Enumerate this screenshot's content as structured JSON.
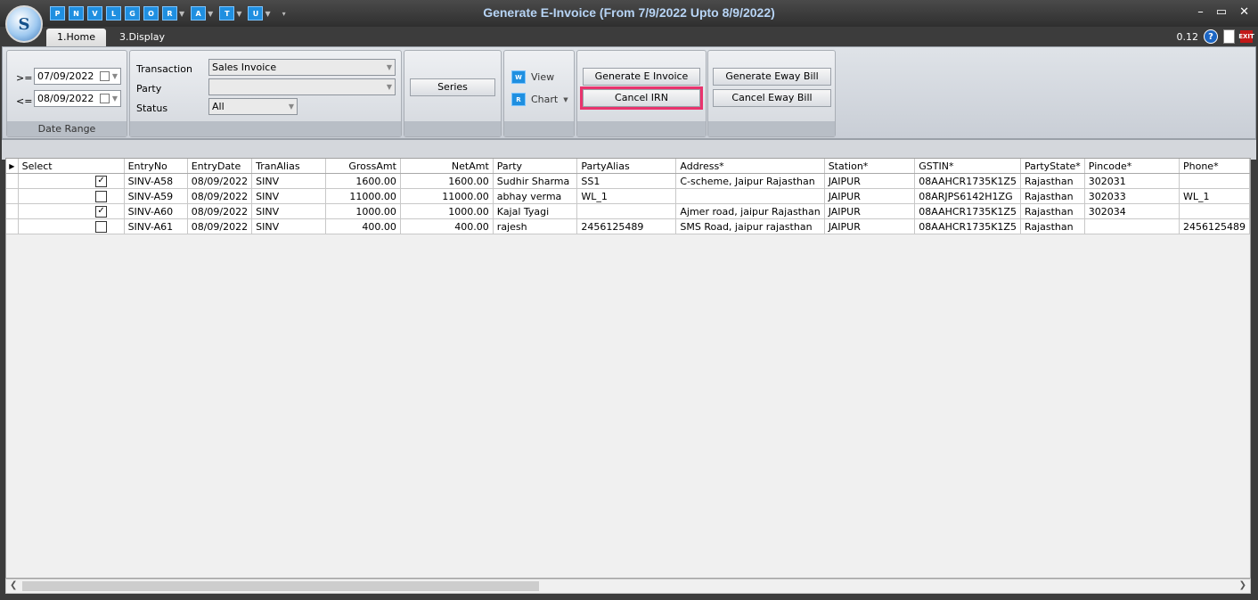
{
  "app": {
    "logo_text": "S",
    "title": "Generate E-Invoice (From 7/9/2022 Upto 8/9/2022)",
    "quick_access": [
      {
        "letter": "P",
        "icon": "p-shortcut-icon"
      },
      {
        "letter": "N",
        "icon": "n-shortcut-icon"
      },
      {
        "letter": "V",
        "icon": "v-shortcut-icon"
      },
      {
        "letter": "L",
        "icon": "l-shortcut-icon"
      },
      {
        "letter": "G",
        "icon": "g-shortcut-icon"
      },
      {
        "letter": "O",
        "icon": "o-shortcut-icon"
      },
      {
        "letter": "R",
        "icon": "r-shortcut-icon"
      },
      {
        "letter": "A",
        "icon": "a-shortcut-icon"
      },
      {
        "letter": "T",
        "icon": "t-shortcut-icon"
      },
      {
        "letter": "U",
        "icon": "u-shortcut-icon"
      }
    ],
    "window_controls": {
      "minimize": "–",
      "maximize": "▭",
      "close": "✕"
    },
    "version": "0.12",
    "help_glyph": "?",
    "exit_glyph": "EXIT"
  },
  "tabs": [
    {
      "label": "1.Home",
      "active": true
    },
    {
      "label": "3.Display",
      "active": false
    }
  ],
  "ribbon": {
    "date_range": {
      "caption": "Date Range",
      "from_label": ">=",
      "from_value": "07/09/2022",
      "to_label": "<=",
      "to_value": "08/09/2022"
    },
    "filters": {
      "transaction_label": "Transaction",
      "transaction_value": "Sales Invoice",
      "party_label": "Party",
      "party_value": "",
      "status_label": "Status",
      "status_value": "All"
    },
    "series_button": "Series",
    "view_button": "View",
    "chart_button": "Chart",
    "generate_e_invoice": "Generate E Invoice",
    "cancel_irn": "Cancel IRN",
    "generate_eway_bill": "Generate Eway Bill",
    "cancel_eway_bill": "Cancel Eway Bill"
  },
  "grid": {
    "columns": [
      "Select",
      "EntryNo",
      "EntryDate",
      "TranAlias",
      "GrossAmt",
      "NetAmt",
      "Party",
      "PartyAlias",
      "Address*",
      "Station*",
      "GSTIN*",
      "PartyState*",
      "Pincode*",
      "Phone*"
    ],
    "rows": [
      {
        "select": true,
        "entry_no": "SINV-A58",
        "entry_date": "08/09/2022",
        "tran_alias": "SINV",
        "gross": "1600.00",
        "net": "1600.00",
        "party": "Sudhir Sharma",
        "party_alias": "SS1",
        "address": "C-scheme, Jaipur Rajasthan",
        "station": "JAIPUR",
        "gstin": "08AAHCR1735K1Z5",
        "state": "Rajasthan",
        "pincode": " 302031",
        "phone": ""
      },
      {
        "select": false,
        "entry_no": "SINV-A59",
        "entry_date": "08/09/2022",
        "tran_alias": "SINV",
        "gross": "11000.00",
        "net": "11000.00",
        "party": "abhay verma",
        "party_alias": "WL_1",
        "address": "",
        "station": "JAIPUR",
        "gstin": "08ARJPS6142H1ZG",
        "state": "Rajasthan",
        "pincode": "302033",
        "phone": "WL_1"
      },
      {
        "select": true,
        "entry_no": "SINV-A60",
        "entry_date": "08/09/2022",
        "tran_alias": "SINV",
        "gross": "1000.00",
        "net": "1000.00",
        "party": "Kajal Tyagi",
        "party_alias": "",
        "address": "Ajmer road, jaipur Rajasthan",
        "station": "JAIPUR",
        "gstin": "08AAHCR1735K1Z5",
        "state": "Rajasthan",
        "pincode": "302034",
        "phone": ""
      },
      {
        "select": false,
        "entry_no": "SINV-A61",
        "entry_date": "08/09/2022",
        "tran_alias": "SINV",
        "gross": "400.00",
        "net": "400.00",
        "party": "rajesh",
        "party_alias": "2456125489",
        "address": "SMS Road, jaipur rajasthan",
        "station": "JAIPUR",
        "gstin": "08AAHCR1735K1Z5",
        "state": "Rajasthan",
        "pincode": "",
        "phone": "2456125489"
      }
    ]
  },
  "colors": {
    "title_text": "#b7d4f5",
    "highlight_outline": "#e8336d",
    "icon_blue": "#1f8fe0"
  }
}
